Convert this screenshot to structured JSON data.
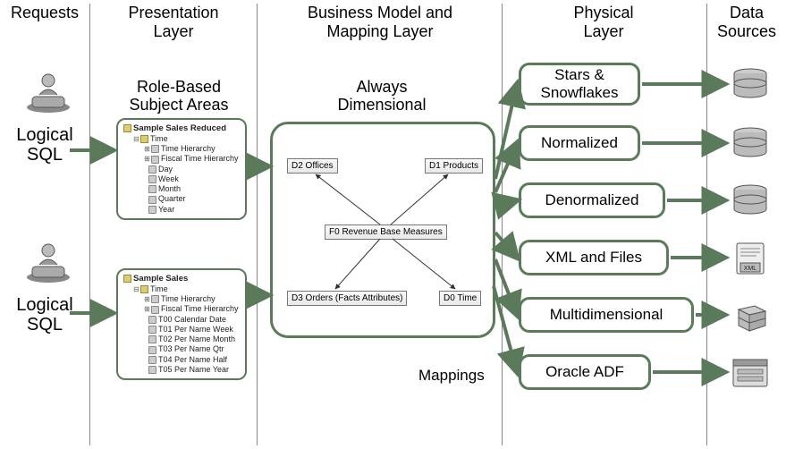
{
  "columns": {
    "requests": "Requests",
    "presentation": "Presentation\nLayer",
    "business": "Business Model and\nMapping Layer",
    "physical": "Physical\nLayer",
    "datasources": "Data\nSources"
  },
  "requests": {
    "logical_sql_1": "Logical\nSQL",
    "logical_sql_2": "Logical\nSQL"
  },
  "presentation": {
    "heading": "Role-Based\nSubject Areas",
    "tree1": {
      "title": "Sample Sales Reduced",
      "folder": "Time",
      "items": [
        "Time Hierarchy",
        "Fiscal Time Hierarchy",
        "Day",
        "Week",
        "Month",
        "Quarter",
        "Year"
      ]
    },
    "tree2": {
      "title": "Sample Sales",
      "folder": "Time",
      "items": [
        "Time Hierarchy",
        "Fiscal Time Hierarchy",
        "T00 Calendar Date",
        "T01 Per Name Week",
        "T02 Per Name Month",
        "T03 Per Name Qtr",
        "T04 Per Name Half",
        "T05 Per Name Year"
      ]
    }
  },
  "business": {
    "heading": "Always\nDimensional",
    "nodes": {
      "d2": "D2 Offices",
      "d1": "D1 Products",
      "f0": "F0 Revenue Base Measures",
      "d3": "D3 Orders (Facts Attributes)",
      "d0": "D0 Time"
    },
    "mappings_label": "Mappings"
  },
  "physical": {
    "stars": "Stars &\nSnowflakes",
    "normalized": "Normalized",
    "denormalized": "Denormalized",
    "xml": "XML and Files",
    "multi": "Multidimensional",
    "adf": "Oracle ADF"
  },
  "datasources": {
    "db": "database-icon",
    "xml": "xml-file-icon",
    "cube": "cube-icon",
    "app": "app-window-icon"
  }
}
